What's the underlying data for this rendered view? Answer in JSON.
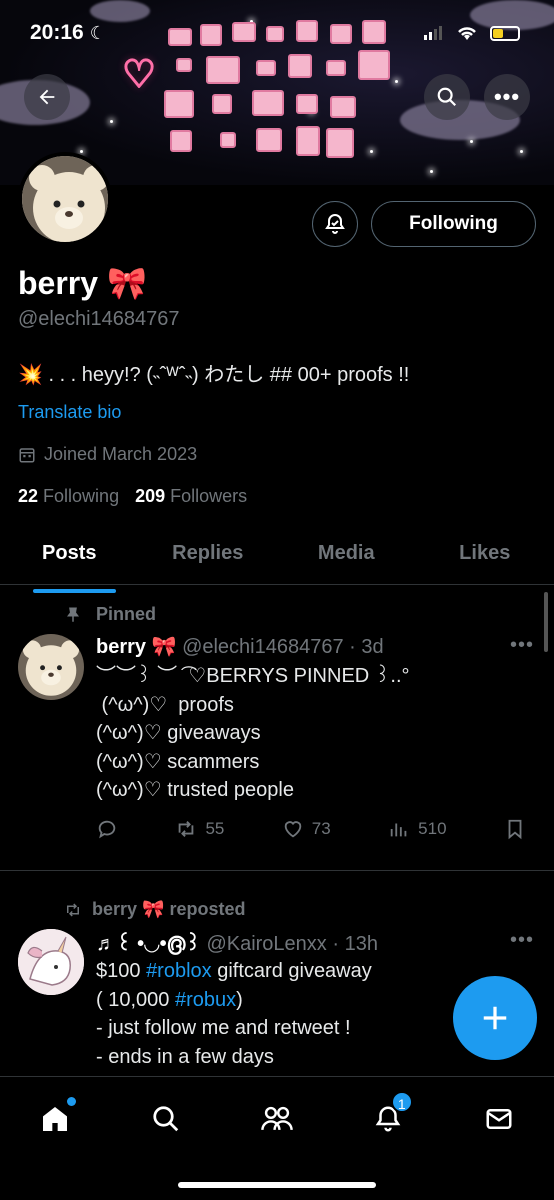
{
  "status_bar": {
    "time": "20:16"
  },
  "profile": {
    "name": "berry",
    "name_emoji": "🎀",
    "handle": "@elechi14684767",
    "bio": "💥 . . . heyy!? (˵ˆᵂˆ˵) わたし ## 00+ proofs !!",
    "translate_label": "Translate bio",
    "joined": "Joined March 2023",
    "following_count": "22",
    "following_label": "Following",
    "followers_count": "209",
    "followers_label": "Followers",
    "follow_button_label": "Following"
  },
  "tabs": [
    "Posts",
    "Replies",
    "Media",
    "Likes"
  ],
  "posts": [
    {
      "context": "Pinned",
      "author": "berry 🎀",
      "meta": "@elechi14684767 · 3d",
      "lines": [
        "︶︶꒱ ︶ ͡ ♡BERRYS PINNED ꒱..°",
        " (^ω^)♡  proofs",
        "(^ω^)♡ giveaways",
        "(^ω^)♡ scammers",
        "(^ω^)♡ trusted people"
      ],
      "retweets": "55",
      "likes": "73",
      "views": "510"
    },
    {
      "context": "berry 🎀 reposted",
      "author": "♬꒰ •◡•൫꒱",
      "meta": "@KairoLenxx · 13h",
      "line1_prefix": "$100 ",
      "line1_tag": "#roblox",
      "line1_suffix": " giftcard giveaway",
      "line2_prefix": "( 10,000 ",
      "line2_tag": "#robux",
      "line2_suffix": ")",
      "line3": "- just follow me and retweet !",
      "line4": "- ends in a few days"
    }
  ],
  "nav": {
    "notifications_badge": "1"
  },
  "colors": {
    "accent": "#1d9bf0",
    "background": "#000000",
    "muted": "#71767b"
  }
}
